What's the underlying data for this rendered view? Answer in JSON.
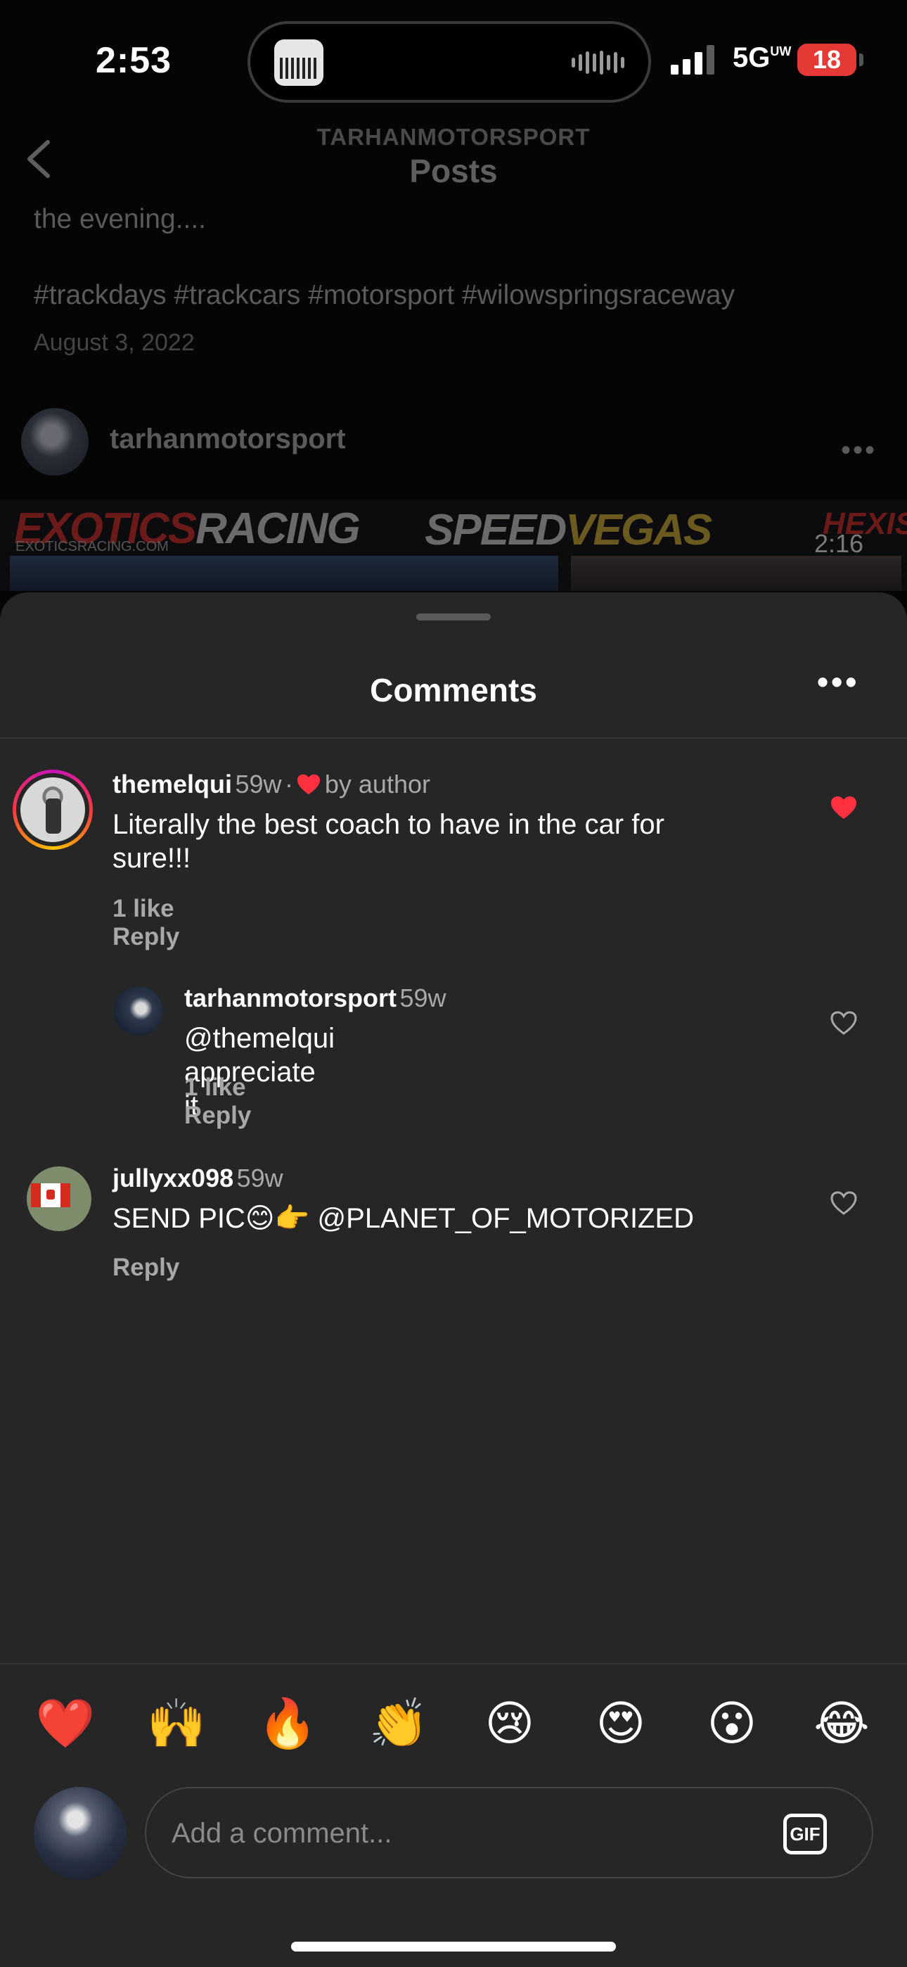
{
  "status_bar": {
    "time": "2:53",
    "network": "5G",
    "network_badge": "UW",
    "battery": "18"
  },
  "nav": {
    "account": "TARHANMOTORSPORT",
    "title": "Posts"
  },
  "post": {
    "caption_tail": "the evening....",
    "hashtags": "#trackdays #trackcars #motorsport #wilowspringsraceway",
    "date": "August 3, 2022",
    "next_user": "tarhanmotorsport",
    "media": {
      "brand1": "EXOTICS",
      "brand1_b": "RACING",
      "brand1_url": "EXOTICSRACING.COM",
      "brand2": "SPEED",
      "brand2_b": "VEGAS",
      "brand3": "HEXIS",
      "video_time": "2:16"
    }
  },
  "comments_sheet": {
    "title": "Comments",
    "comments": [
      {
        "username": "themelqui",
        "age": "59w",
        "badge": "by author",
        "text_line1": "Literally the best coach to have in the car for",
        "text_line2": "sure!!!",
        "likes": "1 like",
        "reply": "Reply",
        "liked": true
      },
      {
        "username": "tarhanmotorsport",
        "age": "59w",
        "text": "@themelqui appreciate it",
        "likes": "1 like",
        "reply": "Reply",
        "liked": false
      },
      {
        "username": "jullyxx098",
        "age": "59w",
        "text": "SEND PIC😊👉 @PLANET_OF_MOTORIZED",
        "reply": "Reply",
        "liked": false
      }
    ]
  },
  "reactions": [
    "❤️",
    "🙌",
    "🔥",
    "👏",
    "😢",
    "😍",
    "😮",
    "😂"
  ],
  "composer": {
    "placeholder": "Add a comment...",
    "gif_label": "GIF"
  },
  "colors": {
    "sheet_bg": "#262626",
    "heart_red": "#ff3040",
    "muted_text": "#a8a8a8"
  }
}
